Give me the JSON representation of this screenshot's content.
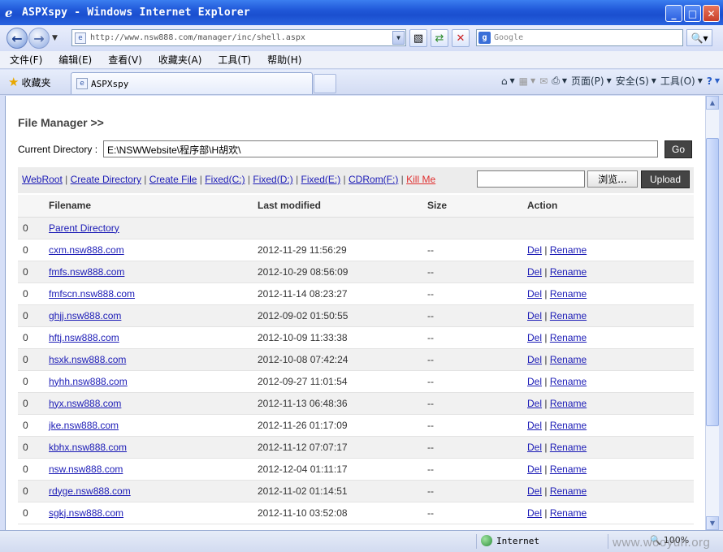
{
  "window": {
    "title": "ASPXspy - Windows Internet Explorer"
  },
  "address": {
    "url": "http://www.nsw888.com/manager/inc/shell.aspx",
    "search_placeholder": "Google"
  },
  "menu": [
    "文件(F)",
    "编辑(E)",
    "查看(V)",
    "收藏夹(A)",
    "工具(T)",
    "帮助(H)"
  ],
  "favorites_label": "收藏夹",
  "tab_label": "ASPXspy",
  "commands": {
    "page": "页面(P)",
    "safety": "安全(S)",
    "tools": "工具(O)"
  },
  "page": {
    "title": "File Manager >>",
    "current_dir_label": "Current Directory :",
    "current_dir_value": "E:\\NSWWebsite\\程序部\\H胡欢\\",
    "go_label": "Go",
    "links": {
      "webroot": "WebRoot",
      "create_dir": "Create Directory",
      "create_file": "Create File",
      "fixed_c": "Fixed(C:)",
      "fixed_d": "Fixed(D:)",
      "fixed_e": "Fixed(E:)",
      "cdrom": "CDRom(F:)",
      "kill": "Kill Me"
    },
    "browse_label": "浏览...",
    "upload_label": "Upload",
    "table": {
      "headers": [
        "Filename",
        "Last modified",
        "Size",
        "Action"
      ],
      "parent": {
        "num": "0",
        "name": "Parent Directory"
      },
      "rows": [
        {
          "num": "0",
          "name": "cxm.nsw888.com",
          "modified": "2012-11-29 11:56:29",
          "size": "--",
          "del": "Del",
          "rename": "Rename"
        },
        {
          "num": "0",
          "name": "fmfs.nsw888.com",
          "modified": "2012-10-29 08:56:09",
          "size": "--",
          "del": "Del",
          "rename": "Rename"
        },
        {
          "num": "0",
          "name": "fmfscn.nsw888.com",
          "modified": "2012-11-14 08:23:27",
          "size": "--",
          "del": "Del",
          "rename": "Rename"
        },
        {
          "num": "0",
          "name": "ghjj.nsw888.com",
          "modified": "2012-09-02 01:50:55",
          "size": "--",
          "del": "Del",
          "rename": "Rename"
        },
        {
          "num": "0",
          "name": "hftj.nsw888.com",
          "modified": "2012-10-09 11:33:38",
          "size": "--",
          "del": "Del",
          "rename": "Rename"
        },
        {
          "num": "0",
          "name": "hsxk.nsw888.com",
          "modified": "2012-10-08 07:42:24",
          "size": "--",
          "del": "Del",
          "rename": "Rename"
        },
        {
          "num": "0",
          "name": "hyhh.nsw888.com",
          "modified": "2012-09-27 11:01:54",
          "size": "--",
          "del": "Del",
          "rename": "Rename"
        },
        {
          "num": "0",
          "name": "hyx.nsw888.com",
          "modified": "2012-11-13 06:48:36",
          "size": "--",
          "del": "Del",
          "rename": "Rename"
        },
        {
          "num": "0",
          "name": "jke.nsw888.com",
          "modified": "2012-11-26 01:17:09",
          "size": "--",
          "del": "Del",
          "rename": "Rename"
        },
        {
          "num": "0",
          "name": "kbhx.nsw888.com",
          "modified": "2012-11-12 07:07:17",
          "size": "--",
          "del": "Del",
          "rename": "Rename"
        },
        {
          "num": "0",
          "name": "nsw.nsw888.com",
          "modified": "2012-12-04 01:11:17",
          "size": "--",
          "del": "Del",
          "rename": "Rename"
        },
        {
          "num": "0",
          "name": "rdyge.nsw888.com",
          "modified": "2012-11-02 01:14:51",
          "size": "--",
          "del": "Del",
          "rename": "Rename"
        },
        {
          "num": "0",
          "name": "sgkj.nsw888.com",
          "modified": "2012-11-10 03:52:08",
          "size": "--",
          "del": "Del",
          "rename": "Rename"
        }
      ]
    }
  },
  "status": {
    "zone": "Internet",
    "zoom": "100%",
    "watermark": "www.wooyun.org"
  }
}
